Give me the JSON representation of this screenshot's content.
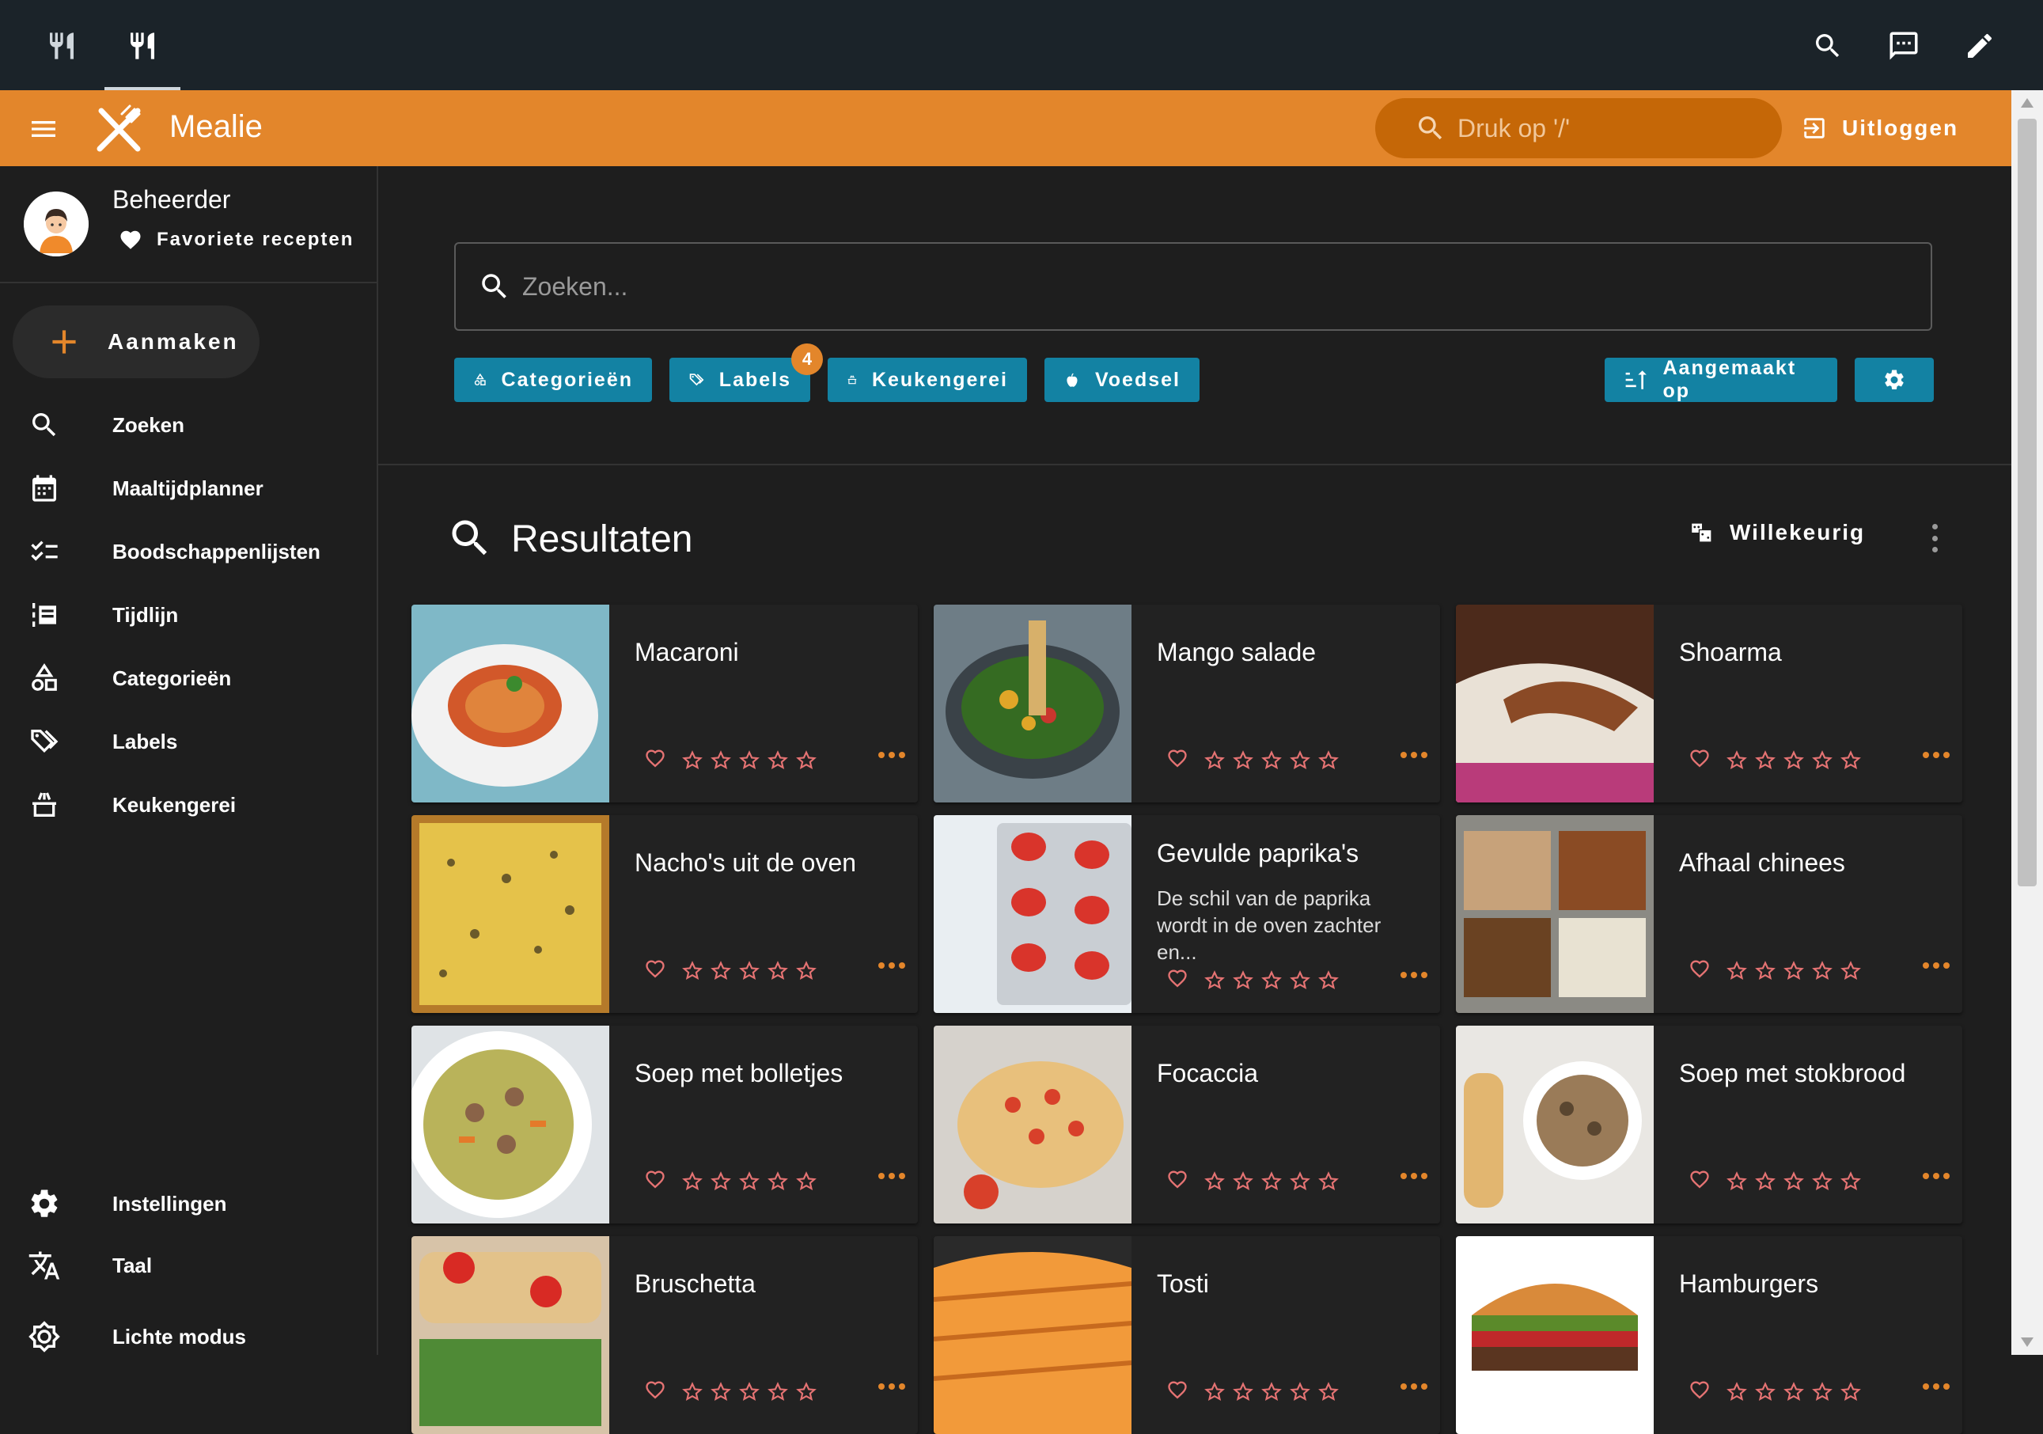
{
  "app": {
    "title": "Mealie",
    "search_placeholder": "Druk op '/'",
    "logout_label": "Uitloggen"
  },
  "user": {
    "name": "Beheerder",
    "favorites_label": "Favoriete recepten"
  },
  "sidebar": {
    "create_label": "Aanmaken",
    "items": [
      {
        "label": "Zoeken",
        "icon": "search-icon"
      },
      {
        "label": "Maaltijdplanner",
        "icon": "calendar-icon"
      },
      {
        "label": "Boodschappenlijsten",
        "icon": "checklist-icon"
      },
      {
        "label": "Tijdlijn",
        "icon": "timeline-icon"
      },
      {
        "label": "Categorieën",
        "icon": "shapes-icon"
      },
      {
        "label": "Labels",
        "icon": "tags-icon"
      },
      {
        "label": "Keukengerei",
        "icon": "pot-icon"
      }
    ],
    "bottom_items": [
      {
        "label": "Instellingen",
        "icon": "gear-icon"
      },
      {
        "label": "Taal",
        "icon": "translate-icon"
      },
      {
        "label": "Lichte modus",
        "icon": "brightness-icon"
      }
    ]
  },
  "search": {
    "placeholder": "Zoeken..."
  },
  "filters": {
    "categories": "Categorieën",
    "labels": "Labels",
    "labels_badge": "4",
    "tools": "Keukengerei",
    "foods": "Voedsel",
    "sort": "Aangemaakt op"
  },
  "results": {
    "title": "Resultaten",
    "random_label": "Willekeurig"
  },
  "recipes": [
    {
      "name": "Macaroni",
      "description": ""
    },
    {
      "name": "Mango salade",
      "description": ""
    },
    {
      "name": "Shoarma",
      "description": ""
    },
    {
      "name": "Nacho's uit de oven",
      "description": ""
    },
    {
      "name": "Gevulde paprika's",
      "description": "De schil van de paprika wordt in de oven zachter en..."
    },
    {
      "name": "Afhaal chinees",
      "description": ""
    },
    {
      "name": "Soep met bolletjes",
      "description": ""
    },
    {
      "name": "Focaccia",
      "description": ""
    },
    {
      "name": "Soep met stokbrood",
      "description": ""
    },
    {
      "name": "Bruschetta",
      "description": ""
    },
    {
      "name": "Tosti",
      "description": ""
    },
    {
      "name": "Hamburgers",
      "description": ""
    }
  ],
  "colors": {
    "accent": "#e3862b",
    "chip": "#1382a3",
    "background": "#1e1e1e",
    "rating": "#e57373"
  }
}
